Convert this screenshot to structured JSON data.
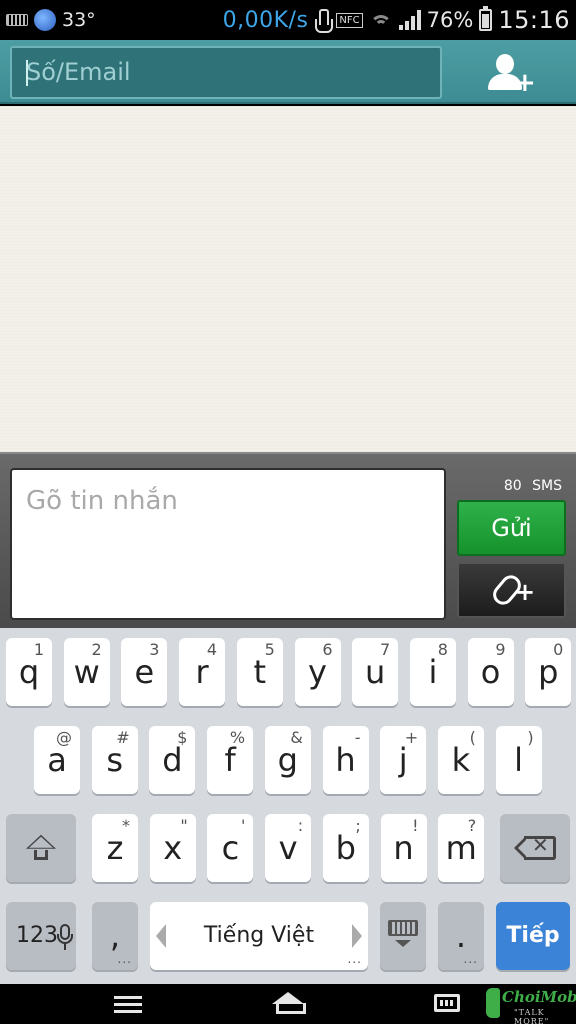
{
  "status_bar": {
    "temperature": "33°",
    "net_speed": "0,00K/s",
    "nfc_label": "NFC",
    "battery_pct": "76%",
    "battery_level": 0.76,
    "time": "15:16"
  },
  "recipient": {
    "placeholder": "Số/Email"
  },
  "compose": {
    "placeholder": "Gõ tin nhắn",
    "sms_count": "80 SMS",
    "send_label": "Gửi"
  },
  "keyboard": {
    "row1": [
      {
        "main": "q",
        "sub": "1"
      },
      {
        "main": "w",
        "sub": "2"
      },
      {
        "main": "e",
        "sub": "3"
      },
      {
        "main": "r",
        "sub": "4"
      },
      {
        "main": "t",
        "sub": "5"
      },
      {
        "main": "y",
        "sub": "6"
      },
      {
        "main": "u",
        "sub": "7"
      },
      {
        "main": "i",
        "sub": "8"
      },
      {
        "main": "o",
        "sub": "9"
      },
      {
        "main": "p",
        "sub": "0"
      }
    ],
    "row2": [
      {
        "main": "a",
        "sub": "@"
      },
      {
        "main": "s",
        "sub": "#"
      },
      {
        "main": "d",
        "sub": "$"
      },
      {
        "main": "f",
        "sub": "%"
      },
      {
        "main": "g",
        "sub": "&"
      },
      {
        "main": "h",
        "sub": "-"
      },
      {
        "main": "j",
        "sub": "+"
      },
      {
        "main": "k",
        "sub": "("
      },
      {
        "main": "l",
        "sub": ")"
      }
    ],
    "row3": [
      {
        "main": "z",
        "sub": "*"
      },
      {
        "main": "x",
        "sub": "\""
      },
      {
        "main": "c",
        "sub": "'"
      },
      {
        "main": "v",
        "sub": ":"
      },
      {
        "main": "b",
        "sub": ";"
      },
      {
        "main": "n",
        "sub": "!"
      },
      {
        "main": "m",
        "sub": "?"
      }
    ],
    "numbers_label": "123",
    "comma": ",",
    "space_label": "Tiếng Việt",
    "period": ".",
    "next_label": "Tiếp",
    "more_dots": "..."
  },
  "watermark": {
    "brand": "ChoiMobile",
    "tagline": "\"TALK MORE\""
  },
  "colors": {
    "header_teal": "#4d9ea4",
    "send_green": "#1a9a30",
    "next_blue": "#3b83d6"
  }
}
